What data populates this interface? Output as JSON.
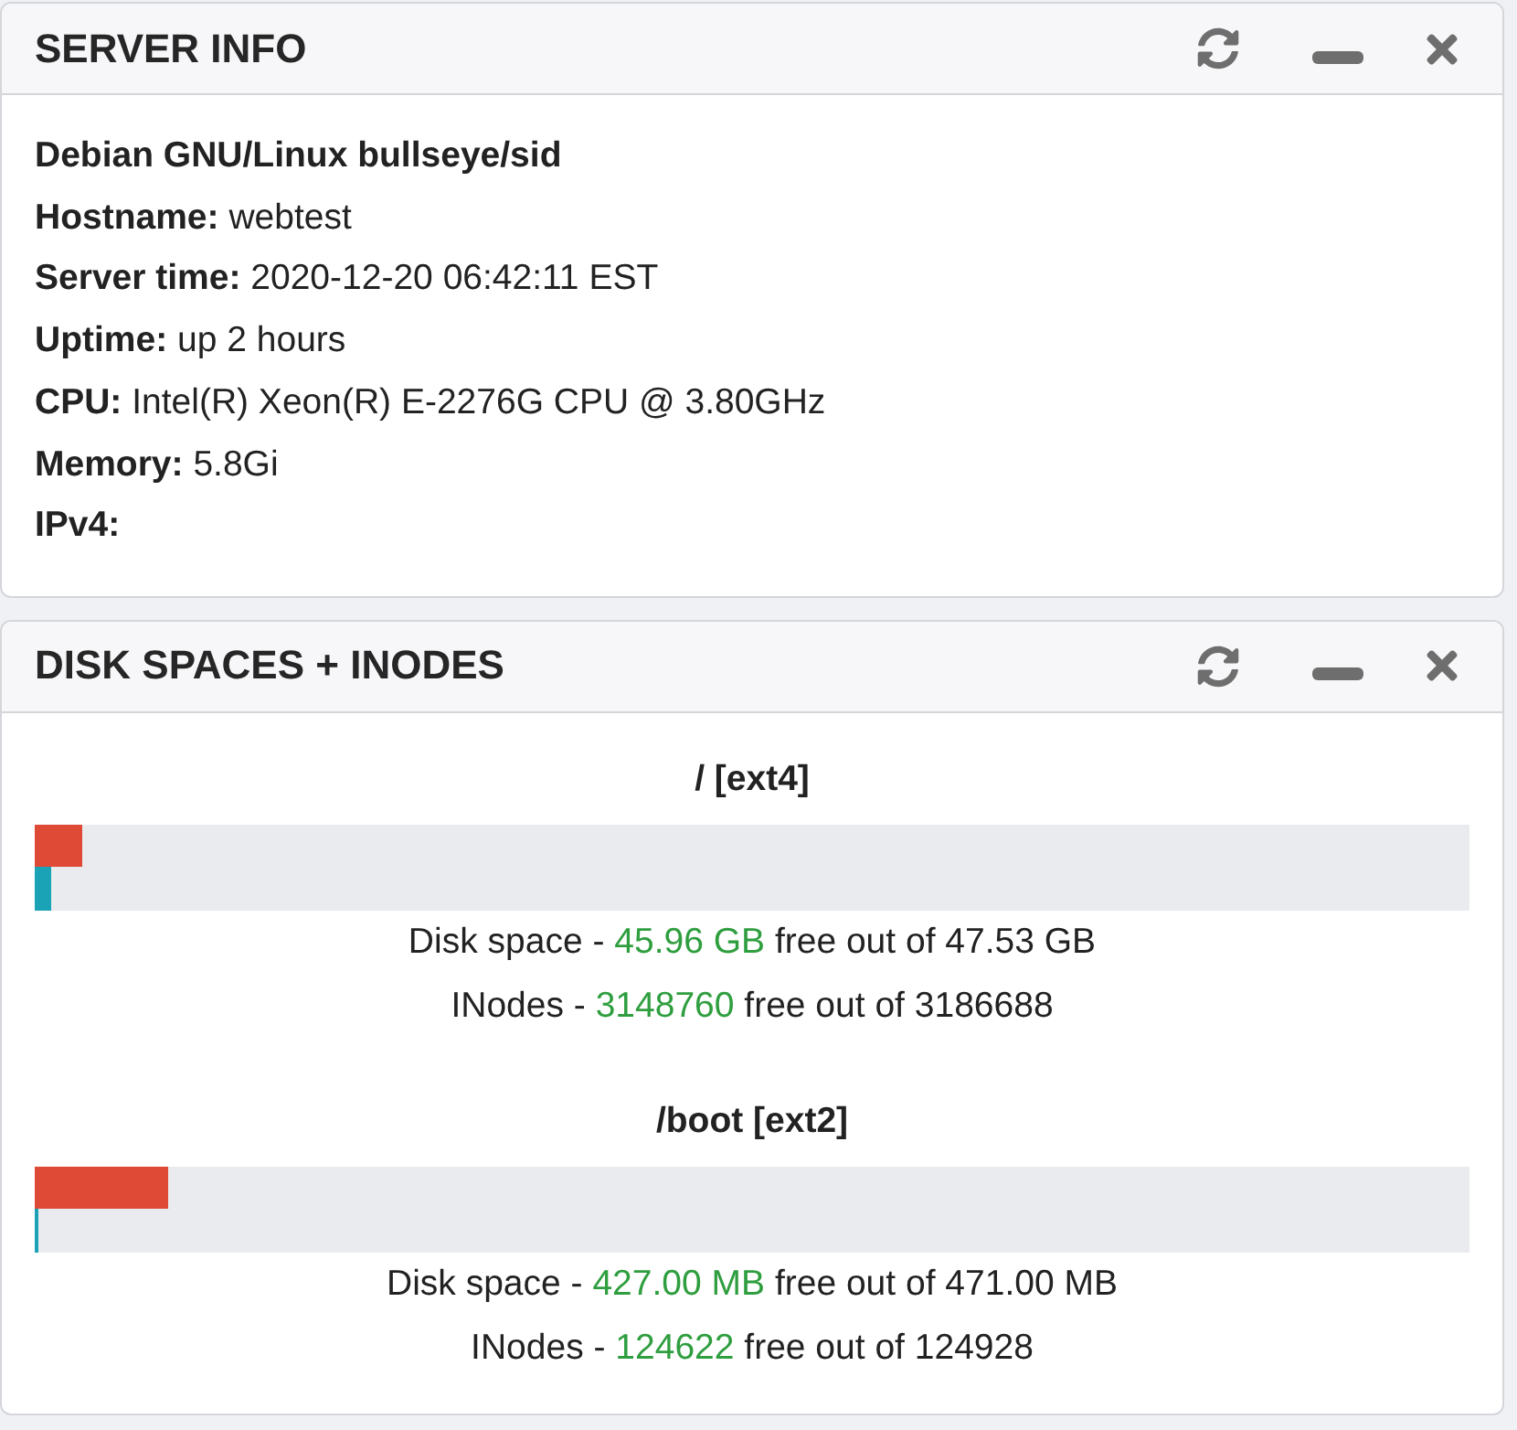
{
  "server_info": {
    "title": "SERVER INFO",
    "os": "Debian GNU/Linux bullseye/sid",
    "fields": [
      {
        "label": "Hostname:",
        "value": "webtest"
      },
      {
        "label": "Server time:",
        "value": "2020-12-20 06:42:11 EST"
      },
      {
        "label": "Uptime:",
        "value": "up 2 hours"
      },
      {
        "label": "CPU:",
        "value": "Intel(R) Xeon(R) E-2276G CPU @ 3.80GHz"
      },
      {
        "label": "Memory:",
        "value": "5.8Gi"
      },
      {
        "label": "IPv4:"
      }
    ]
  },
  "disk_spaces": {
    "title": "DISK SPACES + INODES",
    "mounts": [
      {
        "heading": "/ [ext4]",
        "bars": [
          {
            "kind": "disk",
            "level": 0.033
          },
          {
            "kind": "inodes",
            "level": 0.012
          }
        ],
        "lines": [
          {
            "label": "Disk space -",
            "free": "45.96 GB",
            "rest": "free out of 47.53 GB"
          },
          {
            "label": "INodes -",
            "free": "3148760",
            "rest": "free out of 3186688"
          }
        ]
      },
      {
        "heading": "/boot [ext2]",
        "bars": [
          {
            "kind": "disk",
            "level": 0.093
          },
          {
            "kind": "inodes",
            "level": 0.0025
          }
        ],
        "lines": [
          {
            "label": "Disk space -",
            "free": "427.00 MB",
            "rest": "free out of 471.00 MB"
          },
          {
            "label": "INodes -",
            "free": "124622",
            "rest": "free out of 124928"
          }
        ]
      }
    ]
  }
}
